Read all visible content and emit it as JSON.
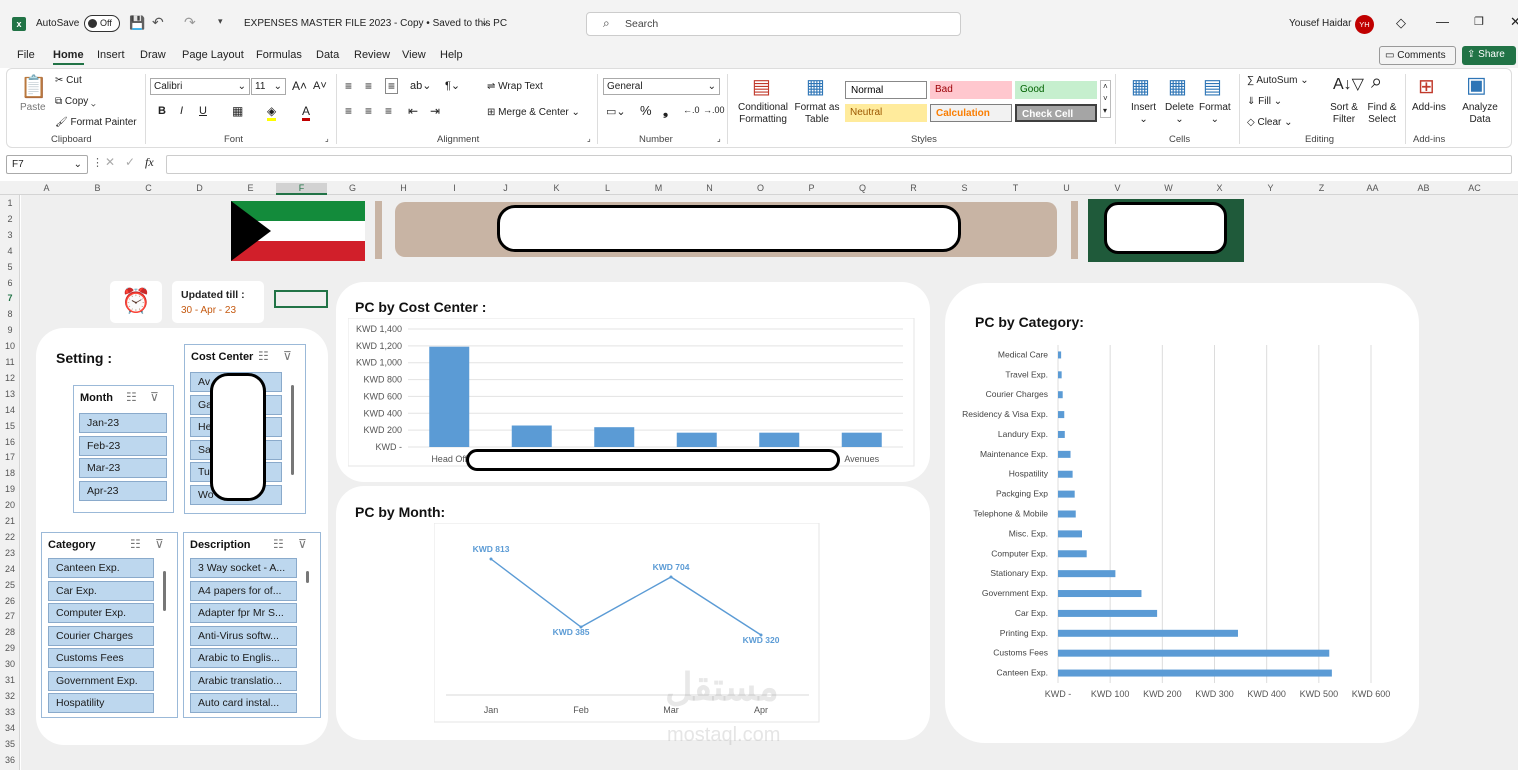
{
  "titlebar": {
    "autosave": "AutoSave",
    "autosave_state": "Off",
    "doc_title": "EXPENSES MASTER FILE 2023 - Copy • Saved to this PC",
    "search_placeholder": "Search",
    "user": "Yousef Haidar",
    "avatar_initials": "YH"
  },
  "menu": [
    "File",
    "Home",
    "Insert",
    "Draw",
    "Page Layout",
    "Formulas",
    "Data",
    "Review",
    "View",
    "Help"
  ],
  "menu_right": {
    "comments": "Comments",
    "share": "Share"
  },
  "ribbon": {
    "clipboard": {
      "paste": "Paste",
      "cut": "Cut",
      "copy": "Copy",
      "format_painter": "Format Painter",
      "label": "Clipboard"
    },
    "font": {
      "name": "Calibri",
      "size": "11",
      "label": "Font"
    },
    "alignment": {
      "wrap": "Wrap Text",
      "merge": "Merge & Center",
      "label": "Alignment"
    },
    "number": {
      "format": "General",
      "label": "Number"
    },
    "styles": {
      "cond": "Conditional Formatting",
      "format_table": "Format as Table",
      "normal": "Normal",
      "bad": "Bad",
      "good": "Good",
      "neutral": "Neutral",
      "calculation": "Calculation",
      "check_cell": "Check Cell",
      "label": "Styles"
    },
    "cells": {
      "insert": "Insert",
      "delete": "Delete",
      "format": "Format",
      "label": "Cells"
    },
    "editing": {
      "autosum": "AutoSum",
      "fill": "Fill",
      "clear": "Clear",
      "sort": "Sort & Filter",
      "find": "Find & Select",
      "label": "Editing"
    },
    "addins": {
      "addins": "Add-ins",
      "analyze": "Analyze Data",
      "label": "Add-ins"
    }
  },
  "formula_bar": {
    "cell_ref": "F7",
    "fx": "fx",
    "value": ""
  },
  "columns": [
    "A",
    "B",
    "C",
    "D",
    "E",
    "F",
    "G",
    "H",
    "I",
    "J",
    "K",
    "L",
    "M",
    "N",
    "O",
    "P",
    "Q",
    "R",
    "S",
    "T",
    "U",
    "V",
    "W",
    "X",
    "Y",
    "Z",
    "AA",
    "AB",
    "AC"
  ],
  "rows": [
    "1",
    "2",
    "3",
    "4",
    "5",
    "6",
    "7",
    "8",
    "9",
    "10",
    "11",
    "12",
    "13",
    "14",
    "15",
    "16",
    "17",
    "18",
    "19",
    "20",
    "21",
    "22",
    "23",
    "24",
    "25",
    "26",
    "27",
    "28",
    "29",
    "30",
    "31",
    "32",
    "33",
    "34",
    "35",
    "36"
  ],
  "dashboard": {
    "updated_label": "Updated till :",
    "updated_value": "30 - Apr - 23",
    "setting_title": "Setting :",
    "slicer_month": {
      "title": "Month",
      "items": [
        "Jan-23",
        "Feb-23",
        "Mar-23",
        "Apr-23"
      ]
    },
    "slicer_cost_center": {
      "title": "Cost Center",
      "items": [
        "Av",
        "Ga",
        "He",
        "Sa",
        "Tu",
        "Wo"
      ]
    },
    "slicer_category": {
      "title": "Category",
      "items": [
        "Canteen Exp.",
        "Car Exp.",
        "Computer Exp.",
        "Courier Charges",
        "Customs Fees",
        "Government Exp.",
        "Hospatility"
      ]
    },
    "slicer_description": {
      "title": "Description",
      "items": [
        "3 Way socket - A...",
        "A4 papers for of...",
        "Adapter fpr Mr S...",
        "Anti-Virus softw...",
        "Arabic to Englis...",
        "Arabic translatio...",
        "Auto card instal..."
      ]
    },
    "watermark": "mostaql.com"
  },
  "colors": {
    "accent": "#5b9bd5",
    "excel_green": "#217346",
    "chart_bar": "#5b9bd5"
  },
  "chart_data": [
    {
      "type": "bar",
      "title": "PC by Cost Center :",
      "categories": [
        "Head Off",
        "",
        "",
        "",
        "",
        "Avenues"
      ],
      "values": [
        1190,
        255,
        235,
        170,
        170,
        170
      ],
      "y_ticks": [
        "KWD -",
        "KWD 200",
        "KWD 400",
        "KWD 600",
        "KWD 800",
        "KWD 1,000",
        "KWD 1,200",
        "KWD 1,400"
      ],
      "ylim": [
        0,
        1400
      ]
    },
    {
      "type": "line",
      "title": "PC by Month:",
      "categories": [
        "Jan",
        "Feb",
        "Mar",
        "Apr"
      ],
      "values": [
        813,
        385,
        704,
        320
      ],
      "data_labels": [
        "KWD 813",
        "KWD 385",
        "KWD 704",
        "KWD 320"
      ]
    },
    {
      "type": "bar",
      "orientation": "horizontal",
      "title": "PC by Category:",
      "categories": [
        "Medical Care",
        "Travel Exp.",
        "Courier Charges",
        "Residency & Visa Exp.",
        "Landury Exp.",
        "Maintenance Exp.",
        "Hospatility",
        "Packging Exp",
        "Telephone & Mobile",
        "Misc. Exp.",
        "Computer Exp.",
        "Stationary Exp.",
        "Government Exp.",
        "Car Exp.",
        "Printing Exp.",
        "Customs Fees",
        "Canteen Exp."
      ],
      "values": [
        6,
        7,
        9,
        12,
        13,
        24,
        28,
        32,
        34,
        46,
        55,
        110,
        160,
        190,
        345,
        520,
        525
      ],
      "x_ticks": [
        "KWD -",
        "KWD 100",
        "KWD 200",
        "KWD 300",
        "KWD 400",
        "KWD 500",
        "KWD 600"
      ],
      "xlim": [
        0,
        600
      ]
    }
  ]
}
